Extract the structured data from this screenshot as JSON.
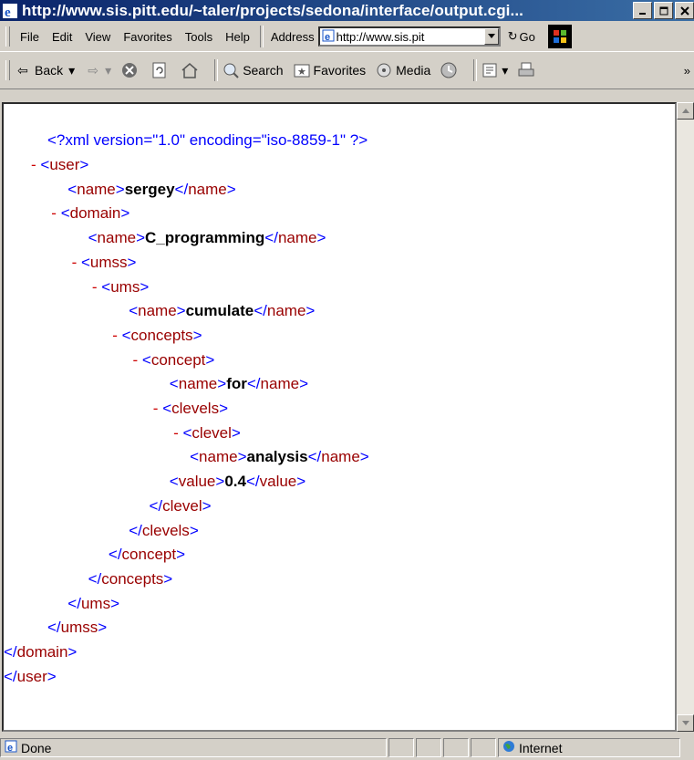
{
  "window": {
    "title": "http://www.sis.pitt.edu/~taler/projects/sedona/interface/output.cgi..."
  },
  "menu": [
    "File",
    "Edit",
    "View",
    "Favorites",
    "Tools",
    "Help"
  ],
  "address": {
    "label": "Address",
    "value": "http://www.sis.pit",
    "go_label": "Go"
  },
  "toolbar": {
    "back": "Back",
    "search": "Search",
    "favorites": "Favorites",
    "media": "Media"
  },
  "xml": {
    "decl": "<?xml version=\"1.0\" encoding=\"iso-8859-1\" ?>",
    "lines": [
      {
        "minus": "",
        "tag": "",
        "open": "",
        "value": "",
        "close": ""
      },
      {
        "minus": "- ",
        "open": "user"
      },
      {
        "open": "name",
        "value": "sergey"
      },
      {
        "minus": "- ",
        "open": "domain"
      },
      {
        "open": "name",
        "value": "C_programming"
      },
      {
        "minus": "- ",
        "open": "umss"
      },
      {
        "minus": "- ",
        "open": "ums"
      },
      {
        "open": "name",
        "value": "cumulate"
      },
      {
        "minus": "- ",
        "open": "concepts"
      },
      {
        "minus": "- ",
        "open": "concept"
      },
      {
        "open": "name",
        "value": "for"
      },
      {
        "minus": "- ",
        "open": "clevels"
      },
      {
        "minus": "- ",
        "open": "clevel"
      },
      {
        "open": "name",
        "value": "analysis"
      },
      {
        "open": "value",
        "value": "0.4"
      },
      {
        "close": "clevel"
      },
      {
        "close": "clevels"
      },
      {
        "close": "concept"
      },
      {
        "close": "concepts"
      },
      {
        "close": "ums"
      },
      {
        "close": "umss"
      },
      {
        "close": "domain"
      },
      {
        "close": "user"
      }
    ]
  },
  "status": {
    "text": "Done",
    "zone": "Internet"
  }
}
